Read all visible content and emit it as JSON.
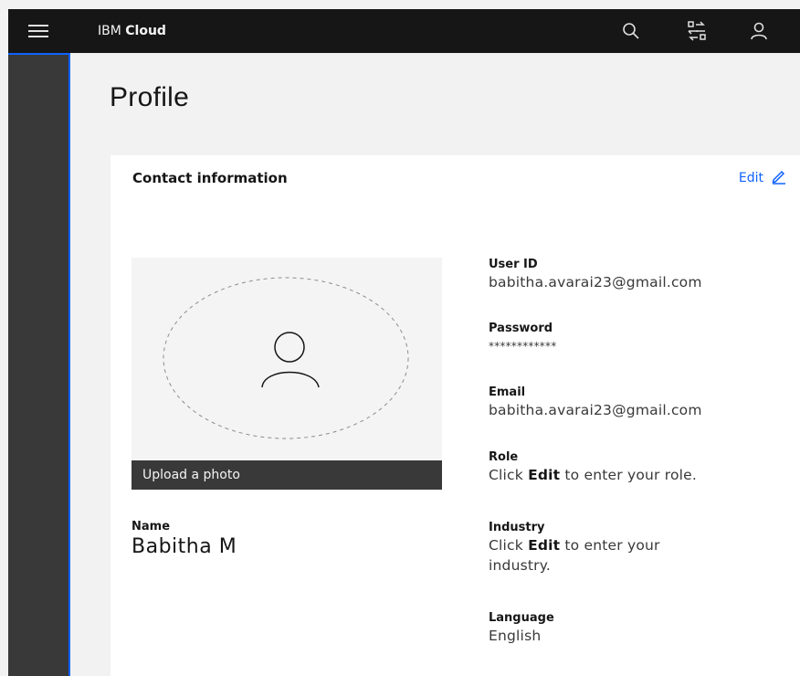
{
  "header": {
    "brand_light": "IBM ",
    "brand_bold": "Cloud"
  },
  "page": {
    "title": "Profile"
  },
  "card": {
    "title": "Contact information",
    "edit_label": "Edit",
    "upload_label": "Upload a photo",
    "name_label": "Name",
    "name_value": "Babitha M"
  },
  "fields": {
    "user_id": {
      "label": "User ID",
      "value": "babitha.avarai23@gmail.com"
    },
    "password": {
      "label": "Password",
      "value": "************"
    },
    "email": {
      "label": "Email",
      "value": "babitha.avarai23@gmail.com"
    },
    "role": {
      "label": "Role",
      "prefix": "Click ",
      "bold": "Edit",
      "suffix": " to enter your role."
    },
    "industry": {
      "label": "Industry",
      "prefix": "Click ",
      "bold": "Edit",
      "suffix": " to enter your industry."
    },
    "language": {
      "label": "Language",
      "value": "English"
    }
  },
  "icons": [
    "menu-icon",
    "search-icon",
    "switcher-icon",
    "user-icon",
    "edit-icon",
    "avatar-icon"
  ]
}
